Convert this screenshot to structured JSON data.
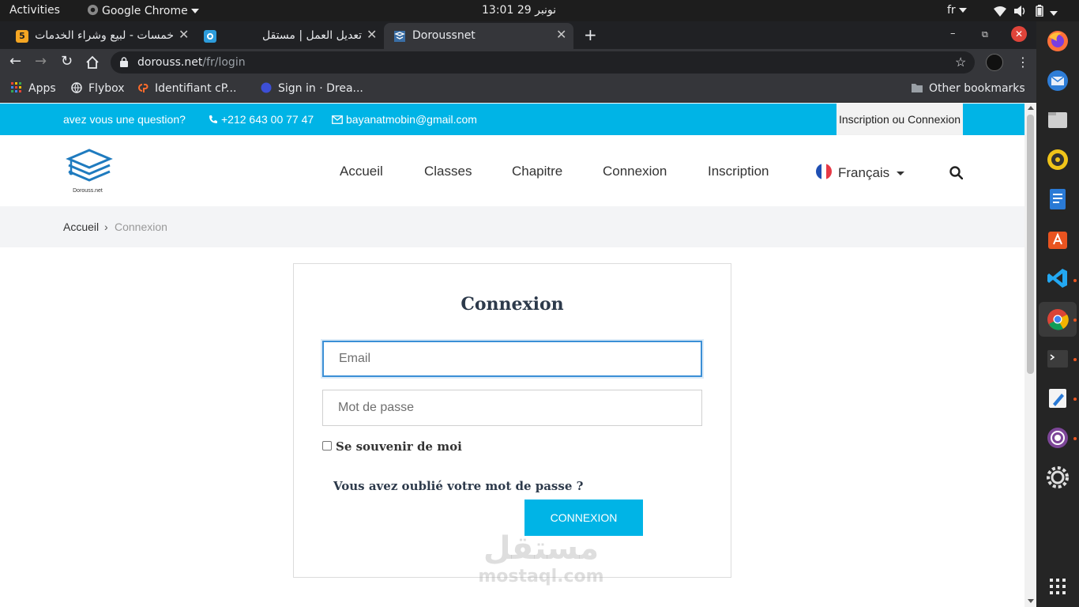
{
  "system_bar": {
    "activities": "Activities",
    "app_name": "Google Chrome",
    "clock": "نونبر 29  13:01",
    "lang": "fr"
  },
  "tabs": [
    {
      "title": "خمسات - لبيع وشراء الخدمات",
      "badge": "5",
      "color": "#f5a623"
    },
    {
      "title": "تعديل العمل | مستقل",
      "color": "#2d9cdb"
    },
    {
      "title": "Doroussnet",
      "active": true
    }
  ],
  "toolbar": {
    "url_host": "dorouss.net",
    "url_path": "/fr/login"
  },
  "bookmarks": [
    {
      "label": "Apps",
      "icon": "apps-grid-icon"
    },
    {
      "label": "Flybox",
      "icon": "globe-icon"
    },
    {
      "label": "Identifiant cP...",
      "icon": "cpanel-icon"
    },
    {
      "label": "Sign in · Drea...",
      "icon": "dream-icon"
    }
  ],
  "other_bookmarks": "Other bookmarks",
  "site": {
    "question": "avez vous une question?",
    "phone": "+212 643 00 77 47",
    "email": "bayanatmobin@gmail.com",
    "login_link": "Inscription ou Connexion",
    "logo_text": "Dorouss.net",
    "menu": [
      "Accueil",
      "Classes",
      "Chapitre",
      "Connexion",
      "Inscription"
    ],
    "language": "Français",
    "accent": "#00b4e6"
  },
  "breadcrumb": {
    "home": "Accueil",
    "separator": "›",
    "current": "Connexion"
  },
  "login": {
    "title": "Connexion",
    "email_placeholder": "Email",
    "password_placeholder": "Mot de passe",
    "remember": "Se souvenir de moi",
    "forgot": "Vous avez oublié votre mot de passe ?",
    "submit": "CONNEXION"
  },
  "watermark": {
    "arabic": "مستقل",
    "latin": "mostaql.com"
  }
}
